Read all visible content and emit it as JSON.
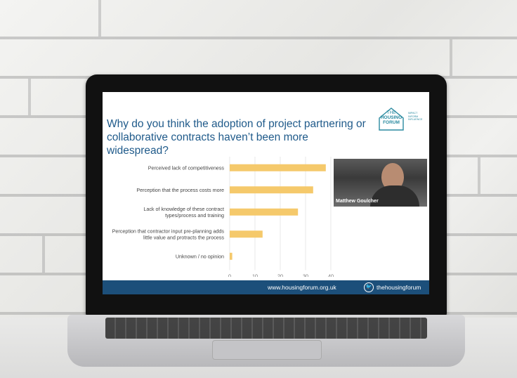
{
  "slide": {
    "title": "Why do you think the adoption of project partnering or collaborative contracts haven’t been more widespread?",
    "logo": {
      "line1": "THE",
      "line2": "HOUSING",
      "line3": "FORUM",
      "tag1": "IMPACT",
      "tag2": "INFORM",
      "tag3": "INFLUENCE"
    },
    "video": {
      "name": "Matthew Goulcher"
    },
    "footer": {
      "url": "www.housingforum.org.uk",
      "twitter": "thehousingforum"
    }
  },
  "chart_data": {
    "type": "bar",
    "orientation": "horizontal",
    "categories": [
      "Perceived lack of competitiveness",
      "Perception that the process costs more",
      "Lack of knowledge of these contract types/process and training",
      "Perception that contractor input pre-planning adds little value and protracts the process",
      "Unknown / no opinion"
    ],
    "category_lines": [
      [
        "Perceived lack of competitiveness"
      ],
      [
        "Perception that the process costs more"
      ],
      [
        "Lack of knowledge of these contract",
        "types/process and training"
      ],
      [
        "Perception that contractor input pre-planning adds",
        "little value and protracts the process"
      ],
      [
        "Unknown / no opinion"
      ]
    ],
    "values": [
      38,
      33,
      27,
      13,
      1
    ],
    "xlim": [
      0,
      40
    ],
    "xticks": [
      "0",
      "10",
      "20",
      "30",
      "40"
    ],
    "grid": true,
    "bar_color": "#f5c96b"
  }
}
